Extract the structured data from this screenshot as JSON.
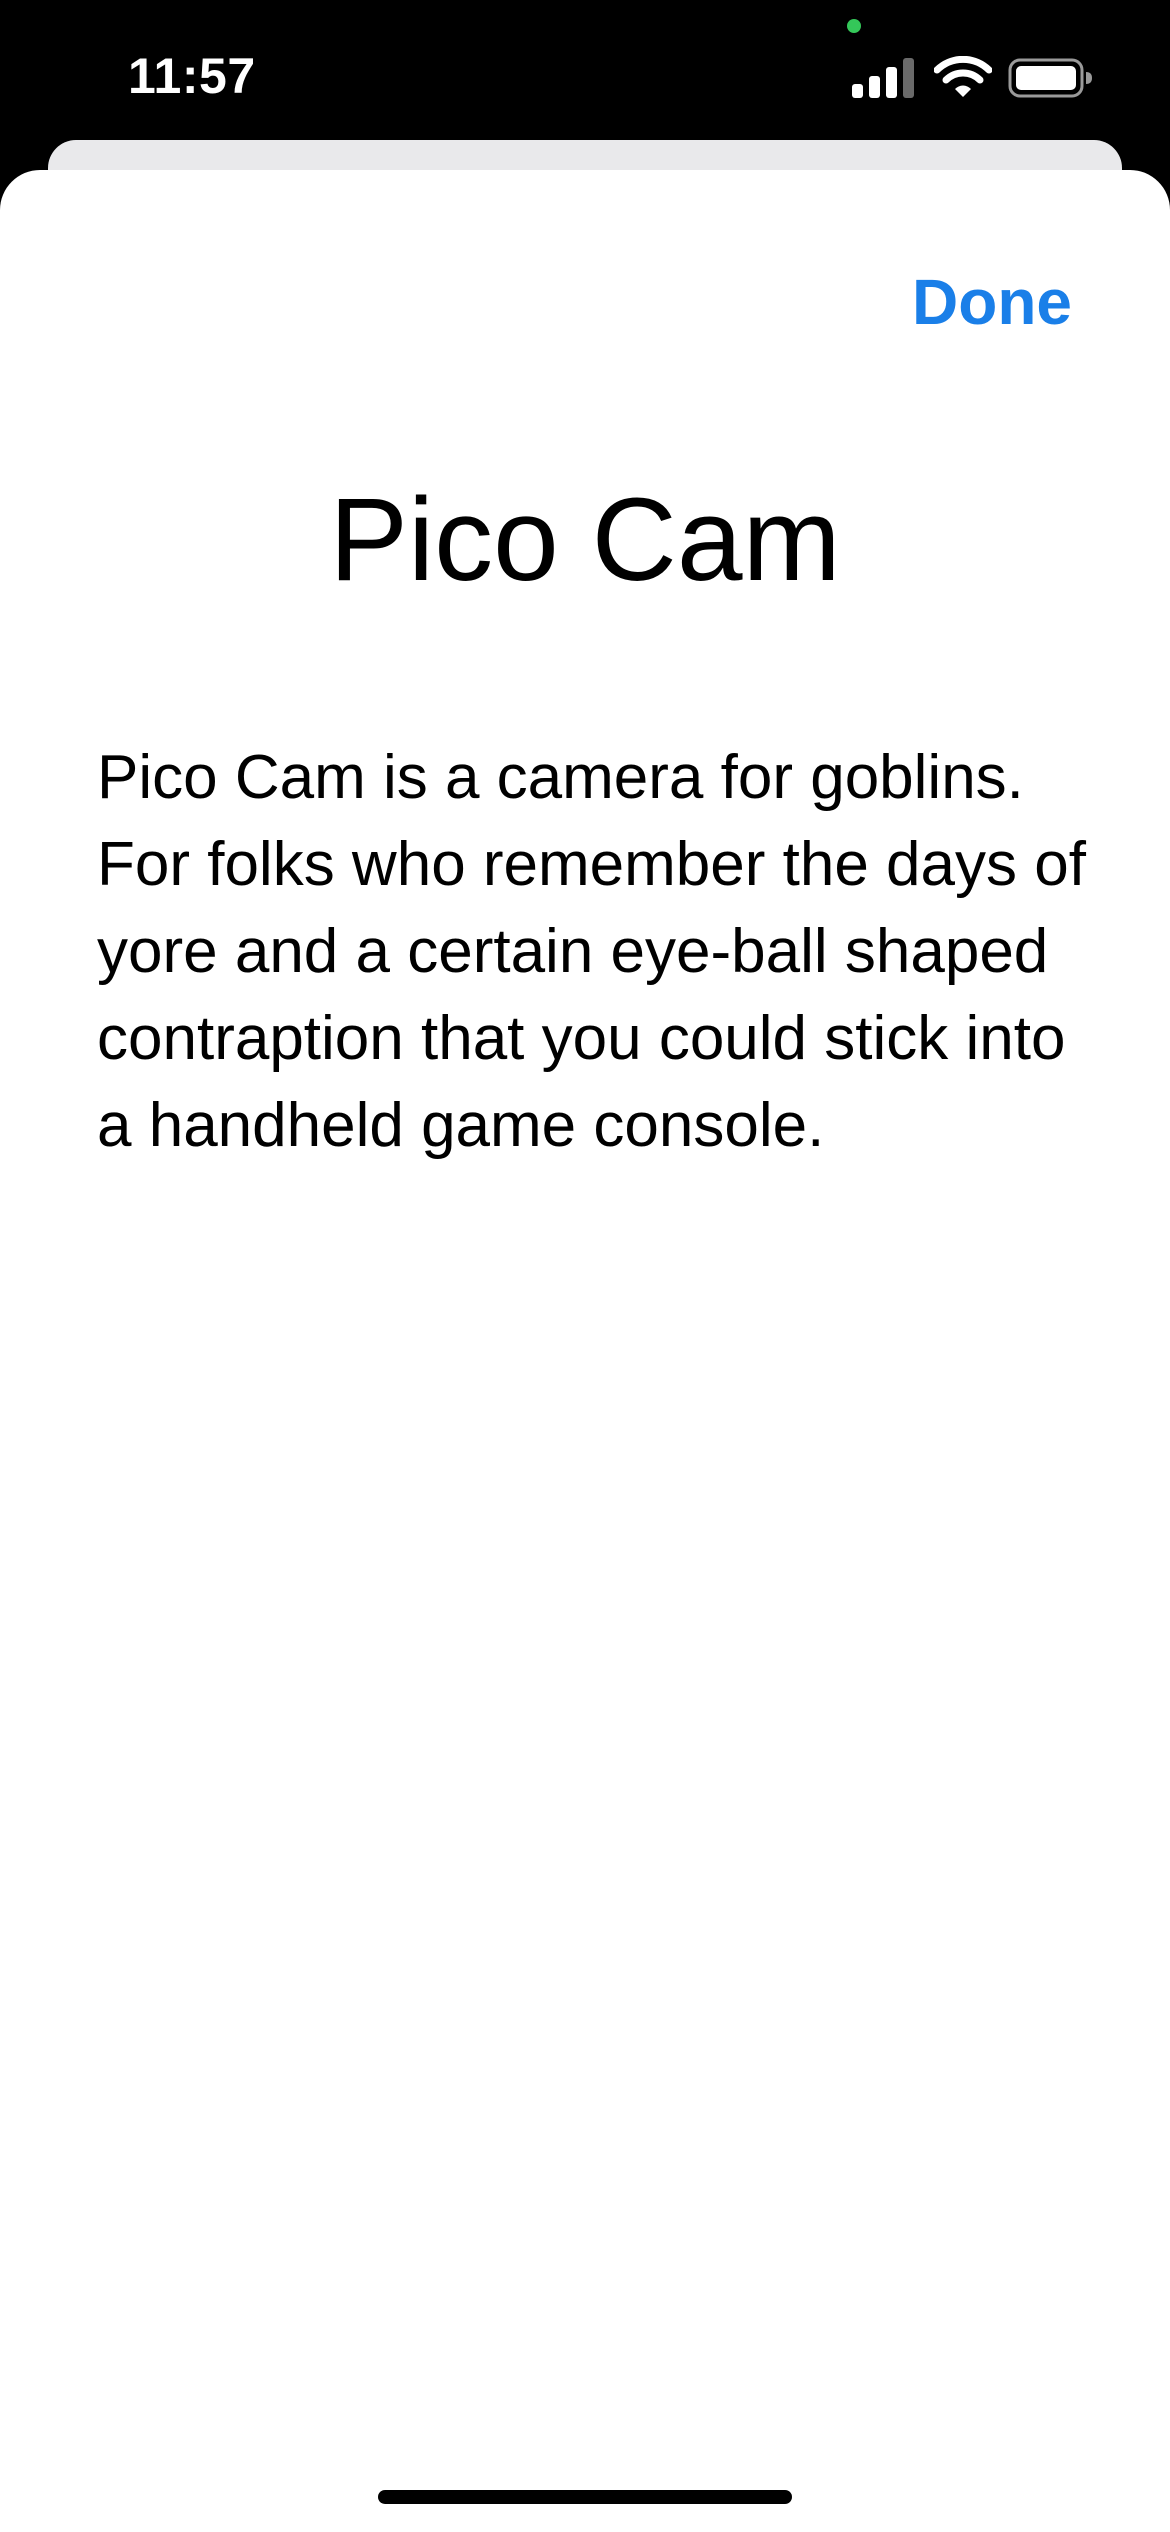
{
  "status_bar": {
    "time": "11:57",
    "icons": [
      "cellular-signal-icon",
      "wifi-icon",
      "battery-icon"
    ],
    "privacy_indicator_color": "#34c759"
  },
  "sheet": {
    "done_label": "Done",
    "title": "Pico Cam",
    "description": "Pico Cam is a camera for goblins. For folks who remember the days of yore and a certain eye-ball shaped contraption that you could stick into a handheld game console."
  },
  "colors": {
    "accent": "#1a7fe8",
    "status_bar_background": "#000000",
    "sheet_background": "#ffffff"
  }
}
